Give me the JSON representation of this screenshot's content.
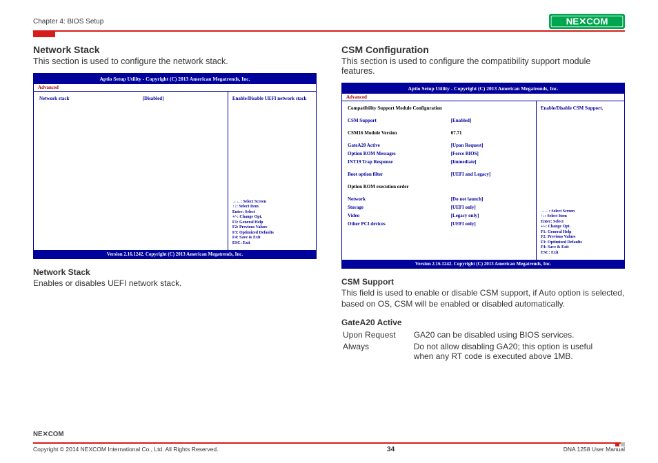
{
  "header": {
    "chapter": "Chapter 4: BIOS Setup",
    "brand": "NEXCOM"
  },
  "left": {
    "title": "Network Stack",
    "subtitle": "This section is used to configure the network stack.",
    "bios": {
      "header": "Aptio Setup Utility - Copyright (C) 2013 American Megatrends, Inc.",
      "tab": "Advanced",
      "rows": [
        {
          "k": "Network stack",
          "v": "[Disabled]"
        }
      ],
      "helpTop": "Enable/Disable UEFI network stack",
      "helpKeys": [
        "→←: Select Screen",
        "↑↓: Select Item",
        "Enter: Select",
        "+/-: Change Opt.",
        "F1: General Help",
        "F2: Previous Values",
        "F3: Optimized Defaults",
        "F4: Save & Exit",
        "ESC: Exit"
      ],
      "footer": "Version 2.16.1242. Copyright (C) 2013 American Megatrends, Inc."
    },
    "desc1Title": "Network Stack",
    "desc1Body": "Enables or disables UEFI network stack."
  },
  "right": {
    "title": "CSM Configuration",
    "subtitle": "This section is used to configure the compatibility support module features.",
    "bios": {
      "header": "Aptio Setup Utility - Copyright (C) 2013 American Megatrends, Inc.",
      "tab": "Advanced",
      "rows": [
        {
          "k": "Compatibility Support Module Configuration",
          "v": "",
          "black": true
        },
        {
          "spacer": true
        },
        {
          "k": "CSM Support",
          "v": "[Enabled]"
        },
        {
          "spacer": true
        },
        {
          "k": "CSM16 Module Version",
          "v": "07.71",
          "black": true
        },
        {
          "spacer": true
        },
        {
          "k": "GateA20 Active",
          "v": "[Upon Request]"
        },
        {
          "k": "Option ROM Messages",
          "v": "[Force BIOS]"
        },
        {
          "k": "INT19 Trap Response",
          "v": "[Immediate]"
        },
        {
          "spacer": true
        },
        {
          "k": "Boot option filter",
          "v": "[UEFI and Legacy]"
        },
        {
          "spacer": true
        },
        {
          "k": "Option ROM execution order",
          "v": "",
          "black": true
        },
        {
          "spacer": true
        },
        {
          "k": "Network",
          "v": "[Do not launch]"
        },
        {
          "k": "Storage",
          "v": "[UEFI only]"
        },
        {
          "k": "Video",
          "v": "[Legacy only]"
        },
        {
          "k": "Other PCI devices",
          "v": "[UEFI only]"
        }
      ],
      "helpTop": "Enable/Disable CSM Support.",
      "helpKeys": [
        "→←: Select Screen",
        "↑↓: Select Item",
        "Enter: Select",
        "+/-: Change Opt.",
        "F1: General Help",
        "F2: Previous Values",
        "F3: Optimized Defaults",
        "F4: Save & Exit",
        "ESC: Exit"
      ],
      "footer": "Version 2.16.1242. Copyright (C) 2013 American Megatrends, Inc."
    },
    "desc1Title": "CSM Support",
    "desc1Body": "This field is used to enable or disable CSM support, if Auto option is selected, based on OS, CSM will be enabled or disabled automatically.",
    "desc2Title": "GateA20 Active",
    "table": [
      {
        "key": "Upon Request",
        "val": "GA20 can be disabled using BIOS services."
      },
      {
        "key": "Always",
        "val": "Do not allow disabling GA20; this option is useful when any RT code is executed above 1MB."
      }
    ]
  },
  "footer": {
    "copyright": "Copyright © 2014 NEXCOM International Co., Ltd. All Rights Reserved.",
    "page": "34",
    "doc": "DNA 1258 User Manual"
  }
}
